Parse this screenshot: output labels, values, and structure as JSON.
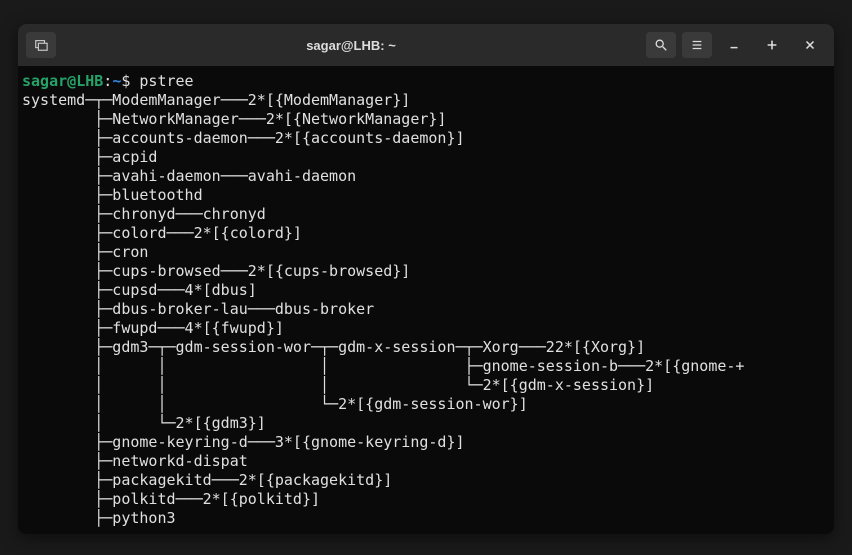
{
  "window": {
    "title": "sagar@LHB: ~"
  },
  "prompt": {
    "user": "sagar",
    "at": "@",
    "host": "LHB",
    "colon": ":",
    "path": "~",
    "dollar": "$ ",
    "command": "pstree"
  },
  "tree": {
    "l0": "systemd─┬─ModemManager───2*[{ModemManager}]",
    "l1": "        ├─NetworkManager───2*[{NetworkManager}]",
    "l2": "        ├─accounts-daemon───2*[{accounts-daemon}]",
    "l3": "        ├─acpid",
    "l4": "        ├─avahi-daemon───avahi-daemon",
    "l5": "        ├─bluetoothd",
    "l6": "        ├─chronyd───chronyd",
    "l7": "        ├─colord───2*[{colord}]",
    "l8": "        ├─cron",
    "l9": "        ├─cups-browsed───2*[{cups-browsed}]",
    "l10": "        ├─cupsd───4*[dbus]",
    "l11": "        ├─dbus-broker-lau───dbus-broker",
    "l12": "        ├─fwupd───4*[{fwupd}]",
    "l13": "        ├─gdm3─┬─gdm-session-wor─┬─gdm-x-session─┬─Xorg───22*[{Xorg}]",
    "l14": "        │      │                 │               ├─gnome-session-b───2*[{gnome-+",
    "l15": "        │      │                 │               └─2*[{gdm-x-session}]",
    "l16": "        │      │                 └─2*[{gdm-session-wor}]",
    "l17": "        │      └─2*[{gdm3}]",
    "l18": "        ├─gnome-keyring-d───3*[{gnome-keyring-d}]",
    "l19": "        ├─networkd-dispat",
    "l20": "        ├─packagekitd───2*[{packagekitd}]",
    "l21": "        ├─polkitd───2*[{polkitd}]",
    "l22": "        ├─python3"
  }
}
